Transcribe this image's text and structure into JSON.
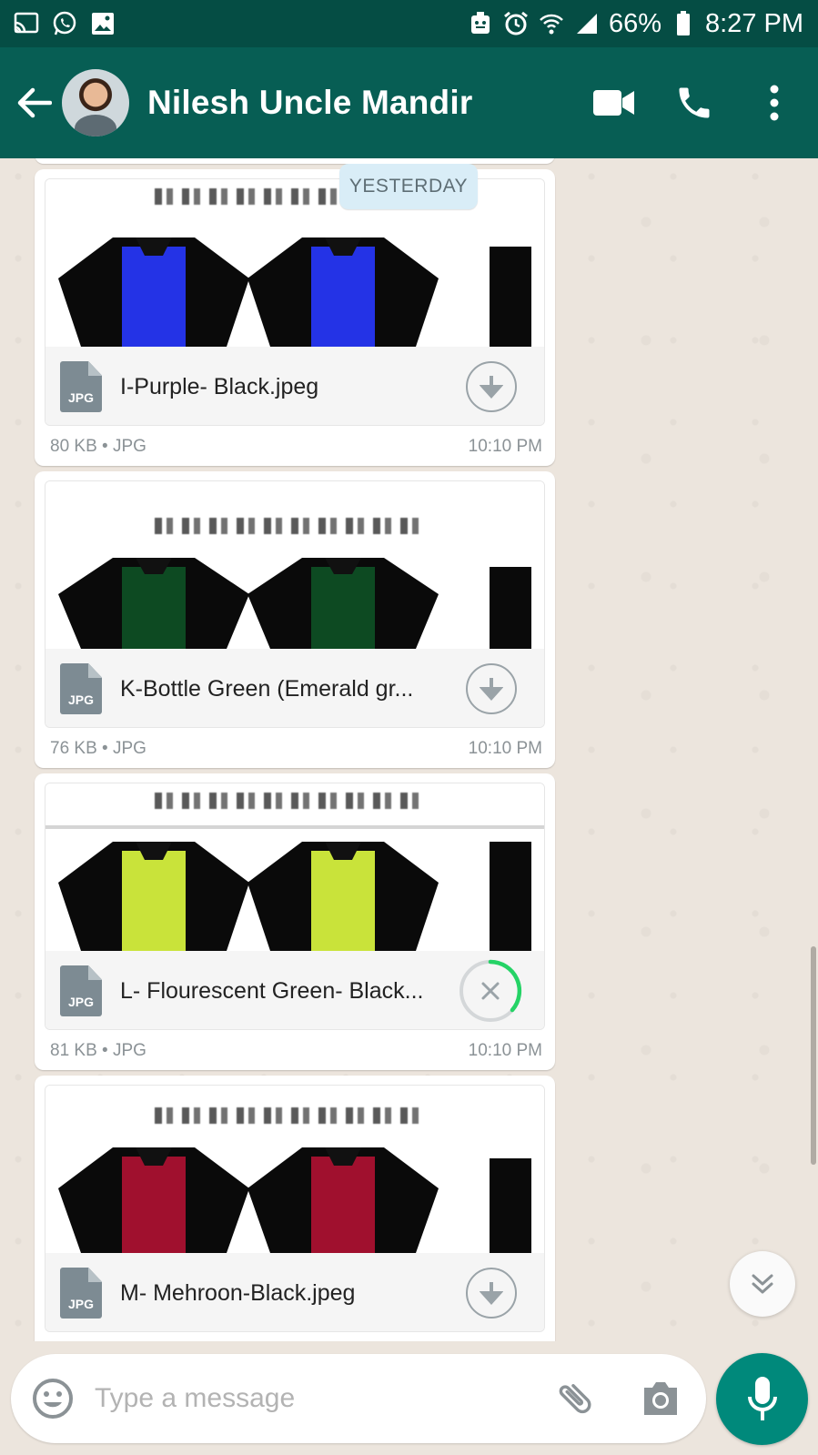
{
  "status_bar": {
    "battery": "66%",
    "time": "8:27 PM",
    "left_icons": [
      "cast-icon",
      "whatsapp-icon",
      "gallery-icon"
    ],
    "right_icons": [
      "face-icon",
      "alarm-icon",
      "wifi-icon",
      "signal-icon",
      "battery-icon"
    ]
  },
  "header": {
    "contact_name": "Nilesh Uncle Mandir",
    "actions": [
      "video-call-icon",
      "voice-call-icon",
      "more-options-icon"
    ]
  },
  "date_chip": "YESTERDAY",
  "messages": [
    {
      "file_name": "I-Purple- Black.jpeg",
      "file_type_badge": "JPG",
      "size": "80 KB",
      "type": "JPG",
      "separator": "•",
      "time": "10:10 PM",
      "state": "download",
      "shirt_color": "#2433e6"
    },
    {
      "file_name": "K-Bottle Green (Emerald gr...",
      "file_type_badge": "JPG",
      "size": "76 KB",
      "type": "JPG",
      "separator": "•",
      "time": "10:10 PM",
      "state": "download",
      "shirt_color": "#0d4a22"
    },
    {
      "file_name": "L- Flourescent Green- Black...",
      "file_type_badge": "JPG",
      "size": "81 KB",
      "type": "JPG",
      "separator": "•",
      "time": "10:10 PM",
      "state": "downloading",
      "shirt_color": "#c9e33a"
    },
    {
      "file_name": "M- Mehroon-Black.jpeg",
      "file_type_badge": "JPG",
      "size": "",
      "type": "",
      "separator": "",
      "time": "",
      "state": "download",
      "shirt_color": "#a0102e"
    }
  ],
  "composer": {
    "placeholder": "Type a message"
  },
  "colors": {
    "header": "#075e54",
    "status_bar": "#054d44",
    "accent": "#00897b",
    "progress": "#25d366"
  }
}
